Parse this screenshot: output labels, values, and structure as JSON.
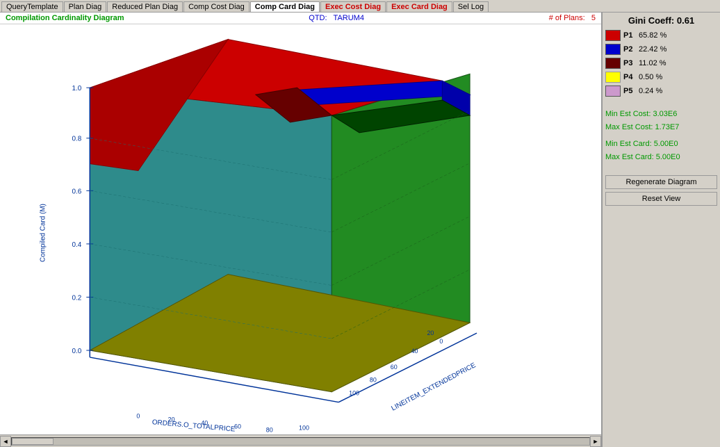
{
  "tabs": [
    {
      "label": "QueryTemplate",
      "active": false
    },
    {
      "label": "Plan Diag",
      "active": false
    },
    {
      "label": "Reduced Plan Diag",
      "active": false
    },
    {
      "label": "Comp Cost Diag",
      "active": false
    },
    {
      "label": "Comp Card Diag",
      "active": true
    },
    {
      "label": "Exec Cost Diag",
      "active": false
    },
    {
      "label": "Exec Card Diag",
      "active": false
    },
    {
      "label": "Sel Log",
      "active": false
    }
  ],
  "info_bar": {
    "title": "Compilation Cardinality Diagram",
    "qtd_label": "QTD:",
    "qtd_value": "TARUM4",
    "nplans_label": "# of Plans:",
    "nplans_value": "5"
  },
  "gini": {
    "title": "Gini Coeff: 0.61"
  },
  "legend": [
    {
      "id": "P1",
      "color": "#cc0000",
      "label": "P1",
      "pct": "65.82 %"
    },
    {
      "id": "P2",
      "color": "#0000cc",
      "label": "P2",
      "pct": "22.42 %"
    },
    {
      "id": "P3",
      "color": "#660000",
      "label": "P3",
      "pct": "11.02 %"
    },
    {
      "id": "P4",
      "color": "#ffff00",
      "label": "P4",
      "pct": "0.50 %"
    },
    {
      "id": "P5",
      "color": "#cc99cc",
      "label": "P5",
      "pct": "0.24 %"
    }
  ],
  "stats": {
    "min_est_cost_label": "Min Est Cost:",
    "min_est_cost_value": "3.03E6",
    "max_est_cost_label": "Max Est Cost:",
    "max_est_cost_value": "1.73E7",
    "min_est_card_label": "Min Est Card:",
    "min_est_card_value": "5.00E0",
    "max_est_card_label": "Max Est Card:",
    "max_est_card_value": "5.00E0"
  },
  "buttons": {
    "regenerate": "Regenerate Diagram",
    "reset": "Reset View"
  },
  "chart": {
    "y_axis_label": "Compiled Card (M)",
    "x_axis_label": "ORDERS.O_TOTALPRICE",
    "z_axis_label": "LINEITEM_EXTENDEDPRICE",
    "y_ticks": [
      "0.0",
      "0.2",
      "0.4",
      "0.6",
      "0.8",
      "1.0"
    ],
    "x_ticks": [
      "0",
      "20",
      "40",
      "60",
      "80",
      "100"
    ],
    "z_ticks": [
      "0",
      "20",
      "40",
      "60",
      "80",
      "100"
    ]
  },
  "scrollbar": {
    "left_arrow": "◄",
    "right_arrow": "►"
  }
}
